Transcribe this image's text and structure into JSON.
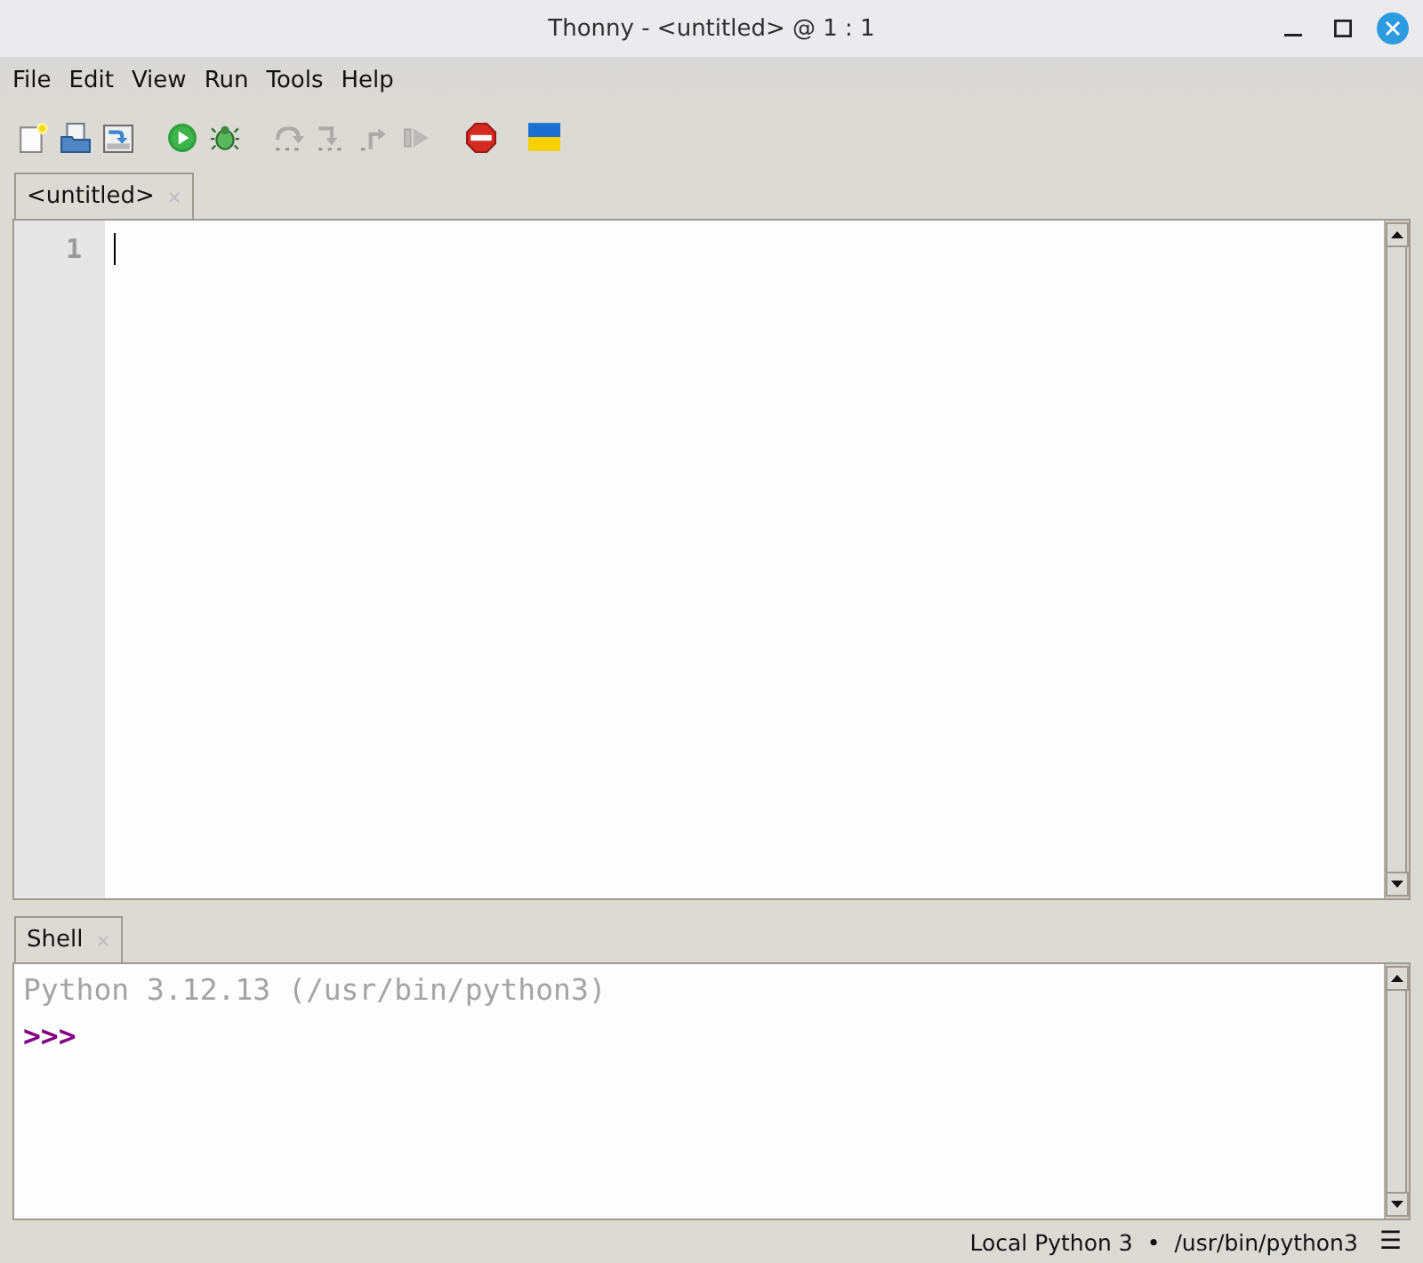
{
  "window": {
    "title": "Thonny - <untitled> @ 1 : 1"
  },
  "menu": [
    "File",
    "Edit",
    "View",
    "Run",
    "Tools",
    "Help"
  ],
  "toolbar": [
    [
      {
        "kind": "new",
        "disabled": false
      },
      {
        "kind": "open",
        "disabled": false
      },
      {
        "kind": "save",
        "disabled": false
      }
    ],
    [
      {
        "kind": "run",
        "disabled": false
      },
      {
        "kind": "debug",
        "disabled": false
      }
    ],
    [
      {
        "kind": "stepover",
        "disabled": true
      },
      {
        "kind": "stepinto",
        "disabled": true
      },
      {
        "kind": "stepout",
        "disabled": true
      },
      {
        "kind": "resume",
        "disabled": true
      }
    ],
    [
      {
        "kind": "stop",
        "disabled": false
      }
    ],
    [
      {
        "kind": "flag",
        "disabled": false
      }
    ]
  ],
  "editor": {
    "tabs": [
      {
        "label": "<untitled>",
        "selected": true
      }
    ],
    "line_numbers": [
      "1"
    ],
    "focused": true
  },
  "shell": {
    "tabs": [
      {
        "label": "Shell",
        "selected": true
      }
    ],
    "lines": [
      {
        "kind": "info",
        "text": "Python 3.12.13 (/usr/bin/python3)"
      },
      {
        "kind": "prompt",
        "text": ">>>"
      }
    ]
  },
  "status_bar": {
    "interpreter": "Local Python 3",
    "separator": "•",
    "path": "/usr/bin/python3",
    "menu_glyph": "☰"
  }
}
